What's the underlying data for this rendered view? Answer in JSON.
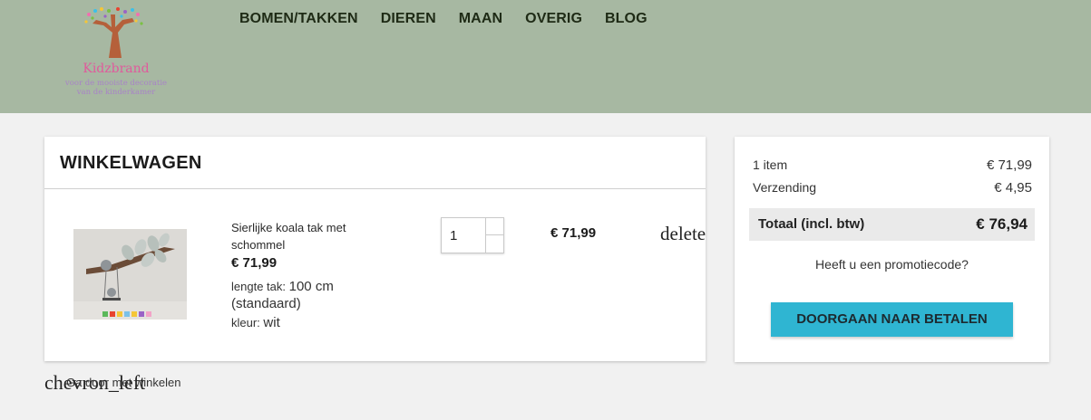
{
  "brand": {
    "name": "Kidzbrand",
    "tagline_line1": "voor de mooiste decoratie",
    "tagline_line2": "van de kinderkamer"
  },
  "nav": {
    "items": [
      {
        "label": "BOMEN/TAKKEN"
      },
      {
        "label": "DIEREN"
      },
      {
        "label": "MAAN"
      },
      {
        "label": "OVERIG"
      },
      {
        "label": "BLOG"
      }
    ]
  },
  "cart": {
    "title": "WINKELWAGEN",
    "item": {
      "name": "Sierlijke koala tak met schommel",
      "price": "€ 71,99",
      "attr1_label": "lengte tak:",
      "attr1_value": "100 cm (standaard)",
      "attr2_label": "kleur:",
      "attr2_value": "wit",
      "quantity": "1",
      "qty_up_icon": "",
      "qty_down_icon": "",
      "line_total": "€ 71,99",
      "delete_label": "delete"
    },
    "continue_icon": "chevron_left",
    "continue_label": "Ga door met winkelen"
  },
  "summary": {
    "items_label": "1 item",
    "items_value": "€ 71,99",
    "shipping_label": "Verzending",
    "shipping_value": "€ 4,95",
    "total_label": "Totaal (incl. btw)",
    "total_value": "€ 76,94",
    "promo_label": "Heeft u een promotiecode?",
    "checkout_label": "DOORGAAN NAAR BETALEN"
  },
  "colors": {
    "header_bg": "#a7b8a2",
    "page_bg": "#f1f1f1",
    "checkout_button": "#2fb5d2",
    "brand_pink": "#e05a9c"
  }
}
